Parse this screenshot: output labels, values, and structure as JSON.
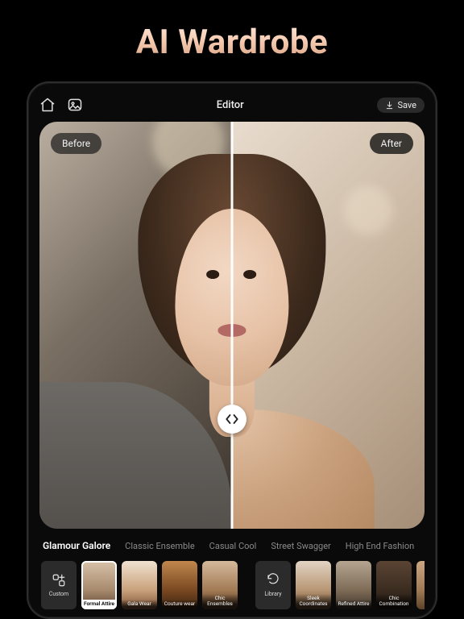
{
  "hero_title": "AI Wardrobe",
  "topbar": {
    "title": "Editor",
    "save_label": "Save"
  },
  "compare": {
    "before_label": "Before",
    "after_label": "After"
  },
  "tabs": [
    {
      "label": "Glamour Galore",
      "active": true
    },
    {
      "label": "Classic Ensemble",
      "active": false
    },
    {
      "label": "Casual Cool",
      "active": false
    },
    {
      "label": "Street Swagger",
      "active": false
    },
    {
      "label": "High End Fashion",
      "active": false
    }
  ],
  "tools": {
    "custom_label": "Custom",
    "library_label": "Library"
  },
  "thumbs_left": [
    {
      "label": "Formal Attire",
      "selected": true
    },
    {
      "label": "Gala Wear",
      "selected": false
    },
    {
      "label": "Couture wear",
      "selected": false
    },
    {
      "label": "Chic Ensembles",
      "selected": false
    }
  ],
  "thumbs_right": [
    {
      "label": "Sleek Coordinates",
      "selected": false
    },
    {
      "label": "Refined Attire",
      "selected": false
    },
    {
      "label": "Chic Combination",
      "selected": false
    }
  ]
}
